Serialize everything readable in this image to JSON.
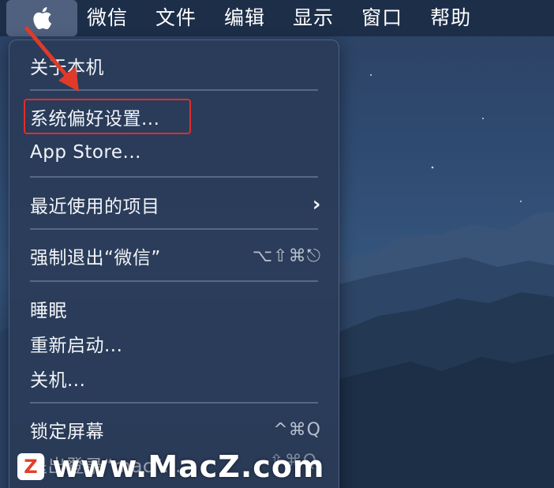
{
  "menubar": {
    "apple_icon": "apple-icon",
    "items": [
      {
        "label": "微信"
      },
      {
        "label": "文件"
      },
      {
        "label": "编辑"
      },
      {
        "label": "显示"
      },
      {
        "label": "窗口"
      },
      {
        "label": "帮助"
      }
    ]
  },
  "menu": {
    "about": "关于本机",
    "preferences": "系统偏好设置...",
    "app_store": "App Store...",
    "recent_items": "最近使用的项目",
    "force_quit": "强制退出“微信”",
    "force_quit_shortcut": "⌥⇧⌘⎋",
    "sleep": "睡眠",
    "restart": "重新启动...",
    "shutdown": "关机...",
    "lock_screen": "锁定屏幕",
    "lock_screen_shortcut": "^⌘Q",
    "logout": "退出登录“mac”...",
    "logout_shortcut": "⇧⌘Q"
  },
  "watermark": {
    "badge": "Z",
    "text": "www.MacZ.com"
  },
  "colors": {
    "highlight": "#e02d2d",
    "arrow": "#e03a2a"
  }
}
